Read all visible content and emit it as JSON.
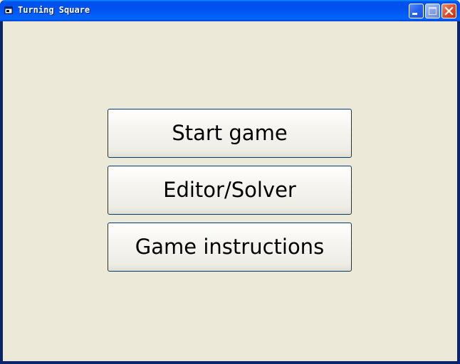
{
  "window": {
    "title": "Turning Square",
    "icon": "app-window-icon",
    "controls": {
      "minimize": "minimize-icon",
      "maximize": "maximize-icon",
      "close": "close-icon"
    }
  },
  "menu": {
    "start_label": "Start game",
    "editor_label": "Editor/Solver",
    "instructions_label": "Game instructions"
  },
  "colors": {
    "titlebar": "#0058ee",
    "client_bg": "#ece9d8",
    "button_border": "#003c74",
    "close_button": "#de4a25"
  }
}
